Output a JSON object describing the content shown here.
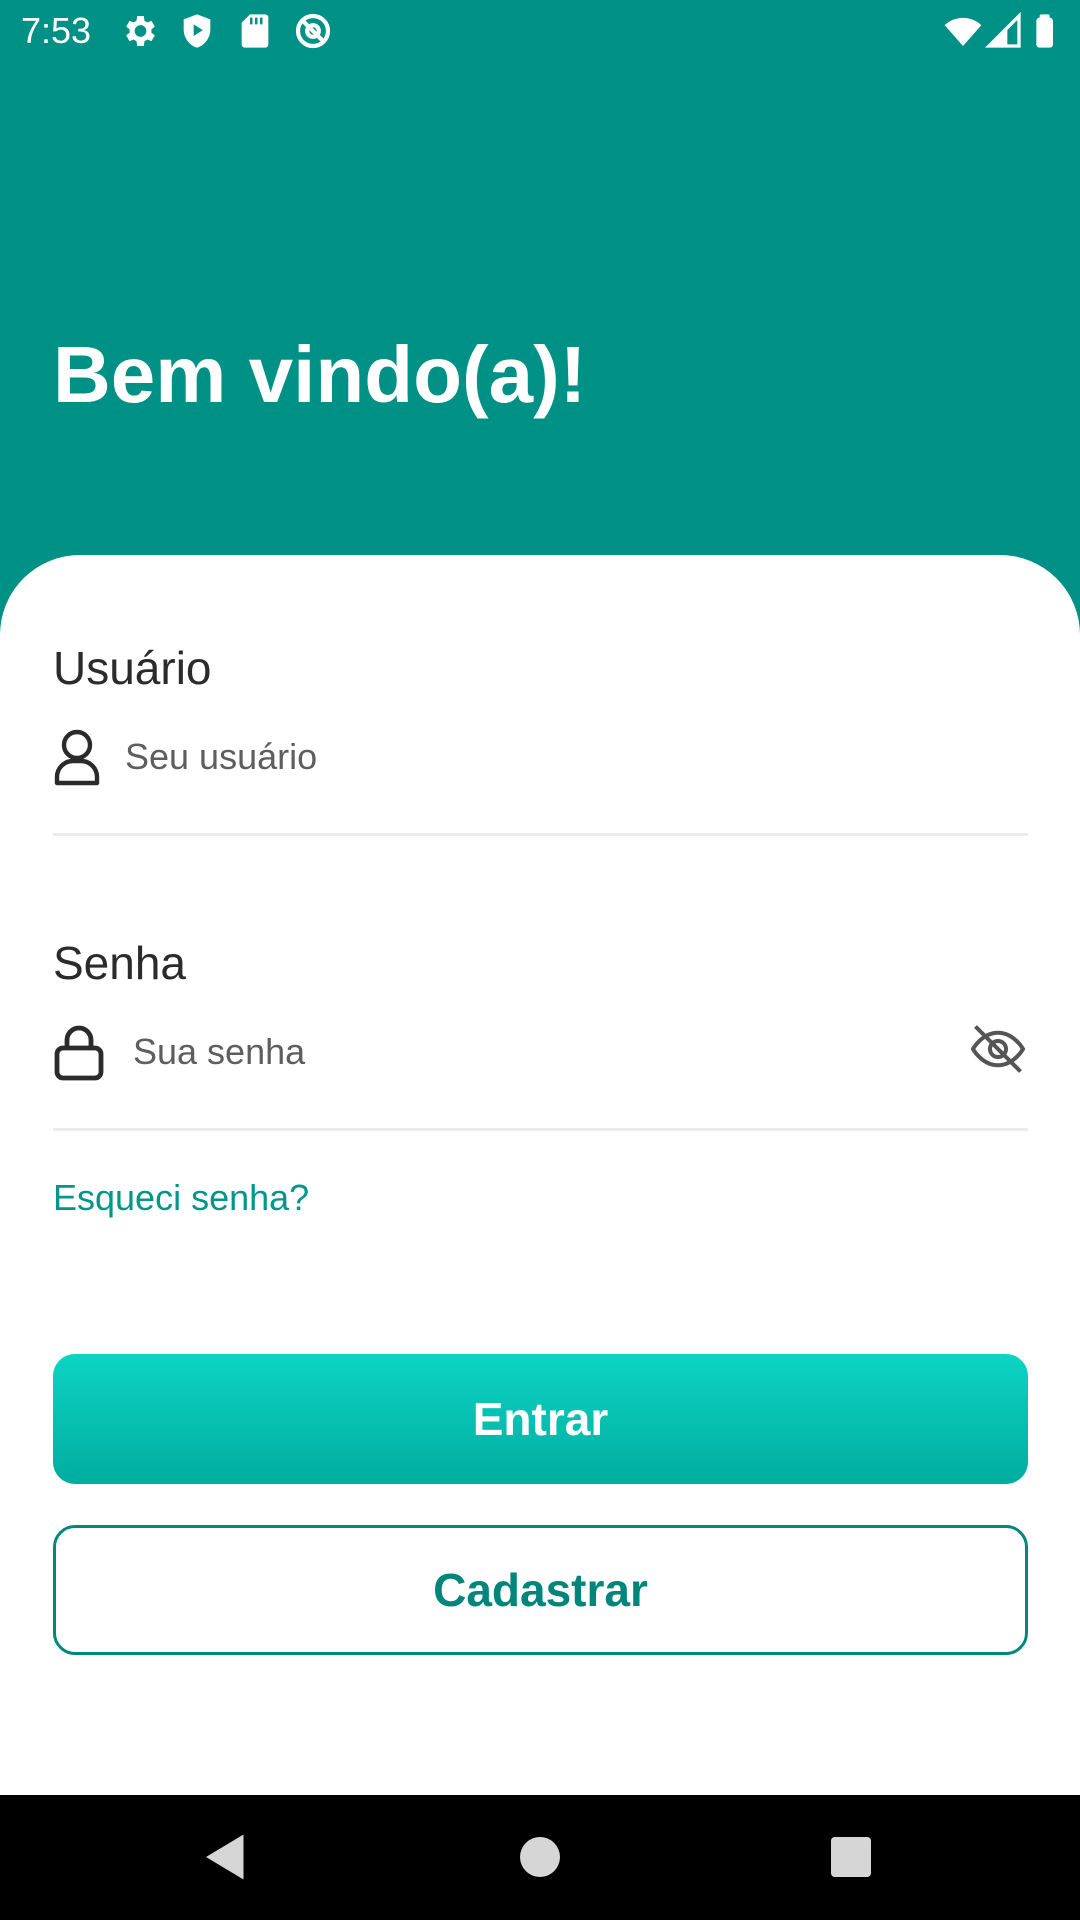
{
  "status_bar": {
    "time": "7:53",
    "left_icons": [
      "gear-icon",
      "shield-play-icon",
      "sd-card-icon",
      "at-sign-icon"
    ],
    "right_icons": [
      "wifi-icon",
      "signal-icon",
      "battery-icon"
    ]
  },
  "header": {
    "title": "Bem vindo(a)!"
  },
  "form": {
    "username": {
      "label": "Usuário",
      "placeholder": "Seu usuário",
      "value": "",
      "icon": "user-icon"
    },
    "password": {
      "label": "Senha",
      "placeholder": "Sua senha",
      "value": "",
      "icon": "lock-icon",
      "toggle_icon": "eye-off-icon"
    },
    "forgot_password": "Esqueci senha?"
  },
  "buttons": {
    "login_label": "Entrar",
    "register_label": "Cadastrar"
  },
  "nav_bar": {
    "icons": [
      "back-icon",
      "home-icon",
      "recents-icon"
    ]
  },
  "colors": {
    "brand": "#009186",
    "accent": "#00968a",
    "button_gradient_top": "#0cd4c3",
    "button_gradient_bottom": "#00ada0"
  }
}
